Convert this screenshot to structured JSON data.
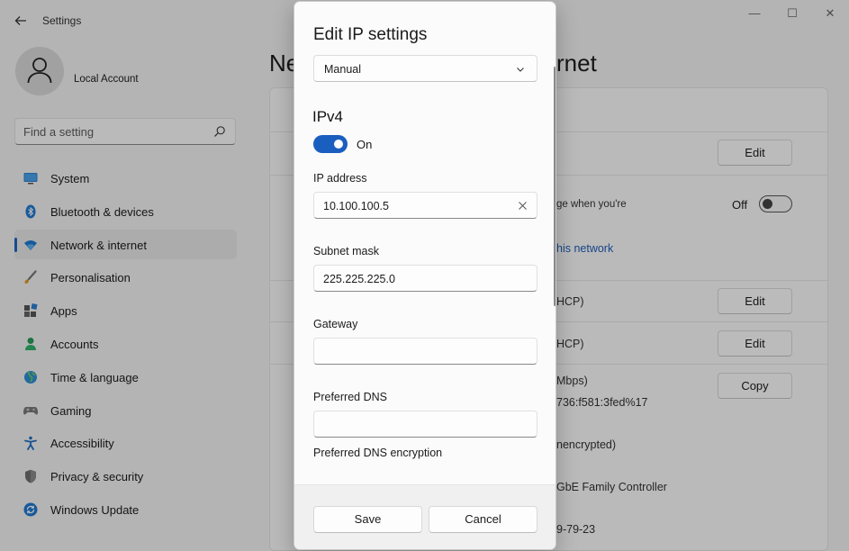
{
  "app": {
    "title": "Settings",
    "window_controls": [
      "—",
      "☐",
      "✕"
    ]
  },
  "profile": {
    "name": "Local Account"
  },
  "search": {
    "placeholder": "Find a setting"
  },
  "sidebar": {
    "items": [
      {
        "label": "System",
        "icon": "system-icon",
        "active": false
      },
      {
        "label": "Bluetooth & devices",
        "icon": "bluetooth-icon",
        "active": false
      },
      {
        "label": "Network & internet",
        "icon": "wifi-icon",
        "active": true
      },
      {
        "label": "Personalisation",
        "icon": "brush-icon",
        "active": false
      },
      {
        "label": "Apps",
        "icon": "apps-icon",
        "active": false
      },
      {
        "label": "Accounts",
        "icon": "accounts-icon",
        "active": false
      },
      {
        "label": "Time & language",
        "icon": "globe-icon",
        "active": false
      },
      {
        "label": "Gaming",
        "icon": "gamepad-icon",
        "active": false
      },
      {
        "label": "Accessibility",
        "icon": "accessibility-icon",
        "active": false
      },
      {
        "label": "Privacy & security",
        "icon": "shield-icon",
        "active": false
      },
      {
        "label": "Windows Update",
        "icon": "update-icon",
        "active": false
      }
    ]
  },
  "background": {
    "title_left": "Ne",
    "title_right": "rnet",
    "buttons": {
      "edit_1": "Edit",
      "edit_2": "Edit",
      "edit_3": "Edit",
      "copy": "Copy"
    },
    "metered_text": "ge when you're",
    "toggle_label": "Off",
    "link_text": "his network",
    "rows": {
      "dhcp_1": "HCP)",
      "dhcp_2": "HCP)",
      "speed": "Mbps)",
      "ipv6": "736:f581:3fed%17",
      "dns_enc": "nencrypted)",
      "adapter": "GbE Family Controller",
      "mac": "9-79-23"
    }
  },
  "dialog": {
    "title": "Edit IP settings",
    "mode": "Manual",
    "section": "IPv4",
    "toggle_label": "On",
    "toggle_on": true,
    "fields": {
      "ip_label": "IP address",
      "ip_value": "10.100.100.5",
      "subnet_label": "Subnet mask",
      "subnet_value": "225.225.225.0",
      "gateway_label": "Gateway",
      "gateway_value": "",
      "dns_label": "Preferred DNS",
      "dns_value": "",
      "dns_enc_label": "Preferred DNS encryption"
    },
    "save_label": "Save",
    "cancel_label": "Cancel"
  },
  "colors": {
    "accent": "#1a5fbf",
    "link": "#1f5fb8"
  }
}
